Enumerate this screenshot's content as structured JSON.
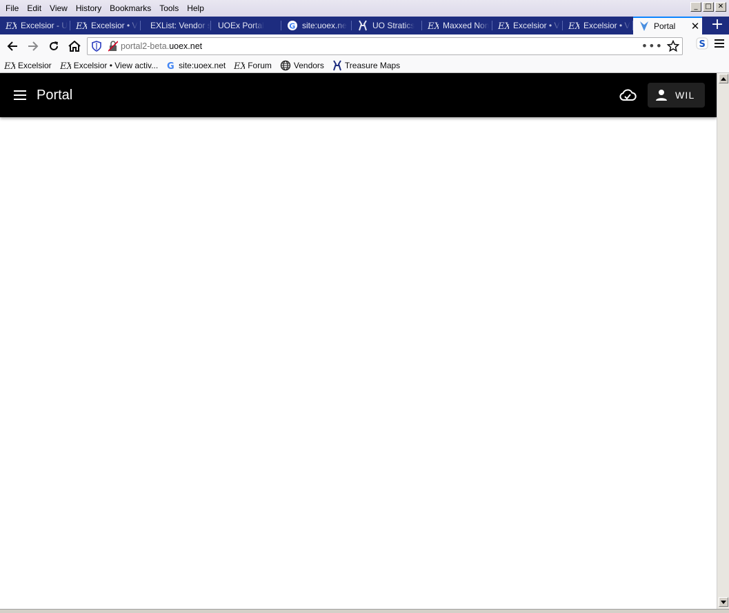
{
  "menubar": {
    "items": [
      "File",
      "Edit",
      "View",
      "History",
      "Bookmarks",
      "Tools",
      "Help"
    ]
  },
  "tabs": [
    {
      "label": "Excelsior - U",
      "icon": "ex-icon"
    },
    {
      "label": "Excelsior • V",
      "icon": "ex-icon"
    },
    {
      "label": "EXList: Vendor se",
      "icon": "none"
    },
    {
      "label": "UOEx Portal",
      "icon": "none"
    },
    {
      "label": "site:uoex.ne",
      "icon": "google-icon"
    },
    {
      "label": "UO Stratics",
      "icon": "stratics-icon"
    },
    {
      "label": "Maxxed Non",
      "icon": "ex-icon"
    },
    {
      "label": "Excelsior • V",
      "icon": "ex-icon"
    },
    {
      "label": "Excelsior • V",
      "icon": "ex-icon"
    }
  ],
  "active_tab": {
    "label": "Portal",
    "icon": "portal-icon"
  },
  "address": {
    "prefix": "portal2-beta.",
    "host": "uoex.net"
  },
  "bookmarks": [
    {
      "label": "Excelsior",
      "icon": "ex-icon"
    },
    {
      "label": "Excelsior • View activ...",
      "icon": "ex-icon"
    },
    {
      "label": "site:uoex.net",
      "icon": "google-icon"
    },
    {
      "label": "Forum",
      "icon": "ex-icon"
    },
    {
      "label": "Vendors",
      "icon": "globe-icon"
    },
    {
      "label": "Treasure Maps",
      "icon": "stratics-icon"
    }
  ],
  "app": {
    "title": "Portal",
    "user_label": "WIL",
    "colors": {
      "appbar": "#000000",
      "user_button": "#212121",
      "tabstrip": "#1d2c7f",
      "active_tab_accent": "#0a84ff"
    }
  }
}
